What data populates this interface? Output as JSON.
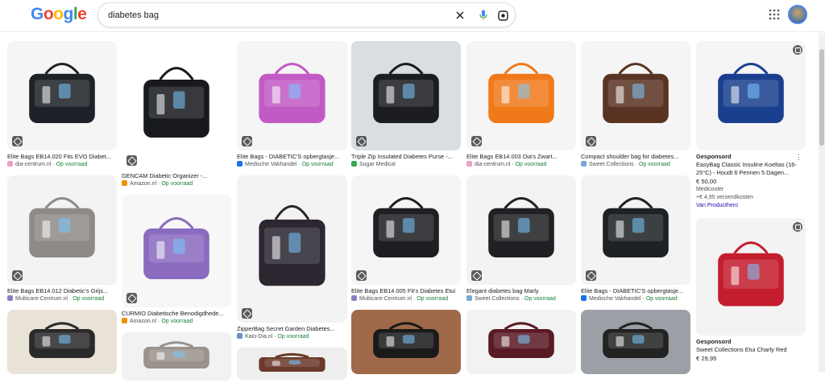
{
  "header": {
    "logo": [
      "G",
      "o",
      "o",
      "g",
      "l",
      "e"
    ],
    "logo_colors": [
      "#4285F4",
      "#EA4335",
      "#FBBC05",
      "#4285F4",
      "#34A853",
      "#EA4335"
    ],
    "search_value": "diabetes bag"
  },
  "colors": {
    "in_stock": "#188038",
    "link": "#1a0dab"
  },
  "columns": [
    [
      {
        "title": "Elite Bags EB14.020 Fits EVO Diabet...",
        "source": "dia-centrum.nl",
        "stock": "Op voorraad",
        "fav": "#e9a0c2",
        "img_h": 136,
        "bg": "#f5f5f5",
        "bag": "#1e2228"
      },
      {
        "title": "Elite Bags EB14.012 Diabetic's Grijs...",
        "source": "Multicare-Centrum.nl",
        "stock": "Op voorraad",
        "fav": "#8e7cc3",
        "img_h": 136,
        "bg": "#f3f3f3",
        "bag": "#8e8a86"
      },
      {
        "title": "",
        "source": "",
        "stock": "",
        "fav": "#ccc",
        "img_h": 80,
        "bg": "#e9e2d6",
        "bag": "#2a2a2a"
      }
    ],
    [
      {
        "title": "GENCAM Diabetic Organizer -...",
        "source": "Amazon.nl",
        "stock": "Op voorraad",
        "fav": "#f29100",
        "img_h": 160,
        "bg": "#ffffff",
        "bag": "#17191c"
      },
      {
        "title": "CURMIO Diabetische Benodigdhede...",
        "source": "Amazon.nl",
        "stock": "Op voorraad",
        "fav": "#f29100",
        "img_h": 140,
        "bg": "#f7f7f7",
        "bag": "#8a6bbf"
      },
      {
        "title": "",
        "source": "",
        "stock": "",
        "fav": "#ccc",
        "img_h": 60,
        "bg": "#f2f2f2",
        "bag": "#9a928c"
      }
    ],
    [
      {
        "title": "Elite Bags - DIABETIC'S opbergtasje...",
        "source": "Medische Vakhandel",
        "stock": "Op voorraad",
        "fav": "#1a73e8",
        "img_h": 136,
        "bg": "#f5f5f5",
        "bag": "#c25ac6"
      },
      {
        "title": "ZipperBag Secret Garden Diabetes...",
        "source": "Kaio-Dia.nl",
        "stock": "Op voorraad",
        "fav": "#6f8fbf",
        "img_h": 183,
        "bg": "#f3f3f3",
        "bag": "#2b2630"
      },
      {
        "title": "",
        "source": "",
        "stock": "",
        "fav": "#ccc",
        "img_h": 40,
        "bg": "#eeeeee",
        "bag": "#6b3a2a"
      }
    ],
    [
      {
        "title": "Triple Zip Insulated Diabetes Purse -...",
        "source": "Sugar Medical",
        "stock": "",
        "fav": "#34a853",
        "img_h": 136,
        "bg": "#d9dee3",
        "bag": "#1b1d20"
      },
      {
        "title": "Elite Bags EB14.005 Fit's Diabetes Etui",
        "source": "Multicare-Centrum.nl",
        "stock": "Op voorraad",
        "fav": "#8e7cc3",
        "img_h": 136,
        "bg": "#f5f5f5",
        "bag": "#1d1f22"
      },
      {
        "title": "",
        "source": "",
        "stock": "",
        "fav": "#ccc",
        "img_h": 80,
        "bg": "#a06a4a",
        "bag": "#1a1a1a"
      }
    ],
    [
      {
        "title": "Elite Bags EB14.003 Dia's Zwart...",
        "source": "dia-centrum.nl",
        "stock": "Op voorraad",
        "fav": "#e9a0c2",
        "img_h": 136,
        "bg": "#f5f5f5",
        "bag": "#f07a1a"
      },
      {
        "title": "Elegant diabetes bag Marly",
        "source": "Sweet Collections",
        "stock": "Op voorraad",
        "fav": "#7aa7d6",
        "img_h": 136,
        "bg": "#f3f3f3",
        "bag": "#202124"
      },
      {
        "title": "",
        "source": "",
        "stock": "",
        "fav": "#ccc",
        "img_h": 80,
        "bg": "#f2f2f2",
        "bag": "#5a1a24"
      }
    ],
    [
      {
        "title": "Compact shoulder bag for diabetes...",
        "source": "Sweet Collections",
        "stock": "Op voorraad",
        "fav": "#7aa7d6",
        "img_h": 136,
        "bg": "#f5f5f5",
        "bag": "#5a3423"
      },
      {
        "title": "Elite Bags - DIABETIC'S opbergtasje...",
        "source": "Medische Vakhandel",
        "stock": "Op voorraad",
        "fav": "#1a73e8",
        "img_h": 136,
        "bg": "#f3f3f3",
        "bag": "#1e2125"
      },
      {
        "title": "",
        "source": "",
        "stock": "",
        "fav": "#ccc",
        "img_h": 80,
        "bg": "#9aa0a6",
        "bag": "#222"
      }
    ]
  ],
  "sponsored": [
    {
      "label": "Gesponsord",
      "title_lines": [
        "EasyBag Classic Insuline Koeltas (16-",
        "25°C) - Houdt 6 Pennen 5 Dagen..."
      ],
      "price": "€ 50,00",
      "seller": "Medicooler",
      "shipping": "+€ 4,95 verzendkosten",
      "link": "Van Producthero",
      "img_h": 136,
      "bg": "#f5f5f5",
      "bag": "#1a3f8f"
    },
    {
      "label": "Gesponsord",
      "title_lines": [
        "Sweet Collections Etui Charly Red"
      ],
      "price": "€ 29,95",
      "seller": "",
      "shipping": "",
      "link": "",
      "img_h": 146,
      "bg": "#f3f3f3",
      "bag": "#c41e2e"
    }
  ]
}
